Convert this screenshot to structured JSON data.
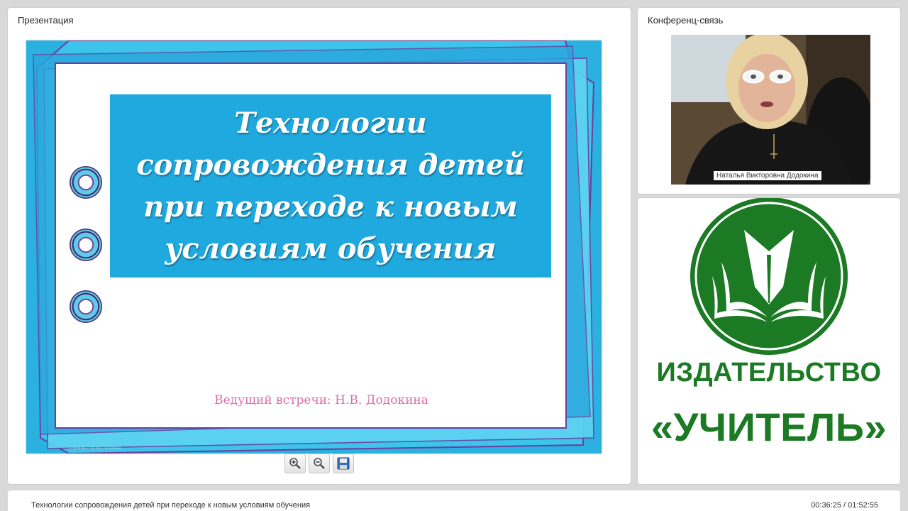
{
  "presentation": {
    "panel_title": "Презентация",
    "slide": {
      "title_lines": [
        "Технологии",
        "сопровождения детей",
        "при переходе к новым",
        "условиям обучения"
      ],
      "host": "Ведущий встречи: Н.В. Додокина",
      "footer": "© Фокина Лилия Петровна"
    },
    "toolbar": [
      {
        "icon": "zoom-in-icon"
      },
      {
        "icon": "zoom-out-icon"
      },
      {
        "icon": "save-icon"
      }
    ]
  },
  "conference": {
    "panel_title": "Конференц-связь",
    "participant_name": "Наталья Викторовна Додокина"
  },
  "logo": {
    "line1": "ИЗДАТЕЛЬСТВО",
    "line2": "«УЧИТЕЛЬ»",
    "color": "#1b7a23"
  },
  "footer": {
    "lesson_title": "Технологии сопровождения детей при переходе к новым условиям обучения",
    "timer": "00:36:25 / 01:52:55"
  }
}
